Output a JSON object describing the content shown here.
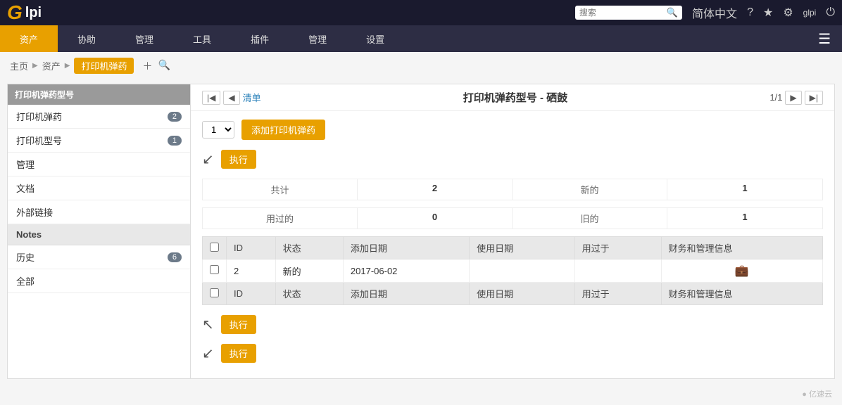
{
  "topbar": {
    "logo_g": "G",
    "logo_lpi": "lpi",
    "search_placeholder": "搜索",
    "lang": "简体中文",
    "help_icon": "?",
    "star_icon": "★",
    "settings_icon": "⚙",
    "username": "glpi",
    "power_icon": "⏻"
  },
  "navbar": {
    "items": [
      {
        "label": "资产",
        "active": true
      },
      {
        "label": "协助",
        "active": false
      },
      {
        "label": "管理",
        "active": false
      },
      {
        "label": "工具",
        "active": false
      },
      {
        "label": "插件",
        "active": false
      },
      {
        "label": "管理",
        "active": false
      },
      {
        "label": "设置",
        "active": false
      }
    ]
  },
  "breadcrumb": {
    "home": "主页",
    "asset": "资产",
    "current": "打印机弹药"
  },
  "sidebar": {
    "section_title": "打印机弹药型号",
    "items": [
      {
        "label": "打印机弹药",
        "badge": "2"
      },
      {
        "label": "打印机型号",
        "badge": "1"
      },
      {
        "label": "管理",
        "badge": null
      },
      {
        "label": "文档",
        "badge": null
      },
      {
        "label": "外部链接",
        "badge": null
      },
      {
        "label": "Notes",
        "badge": null,
        "is_notes": true
      },
      {
        "label": "历史",
        "badge": "6"
      },
      {
        "label": "全部",
        "badge": null
      }
    ]
  },
  "panel": {
    "list_link": "清单",
    "title": "打印机弹药型号 - 硒鼓",
    "pagination": "1/1",
    "add_button": "添加打印机弹药",
    "execute_button": "执行",
    "qty_default": "1",
    "stats": [
      {
        "label": "共计",
        "value": "2"
      },
      {
        "label": "用过的",
        "value": "0"
      },
      {
        "label": "新的",
        "value": "1"
      },
      {
        "label": "旧的",
        "value": "1"
      }
    ],
    "table_headers": [
      "",
      "ID",
      "状态",
      "添加日期",
      "使用日期",
      "用过于",
      "财务和管理信息"
    ],
    "table_rows": [
      {
        "id": "2",
        "status": "新的",
        "add_date": "2017-06-02",
        "use_date": "",
        "used_by": "",
        "finance": "💼"
      }
    ],
    "table_headers_bottom": [
      "",
      "ID",
      "状态",
      "添加日期",
      "使用日期",
      "用过于",
      "财务和管理信息"
    ]
  },
  "watermark": "● 亿速云"
}
